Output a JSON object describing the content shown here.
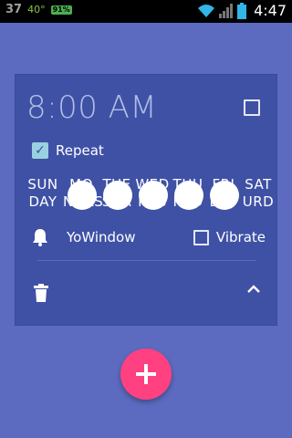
{
  "status_bar": {
    "left_number": "37",
    "weather_temp": "40°",
    "badge": "91%",
    "clock": "4:47"
  },
  "alarm": {
    "time": "8:00 AM",
    "enabled": false,
    "repeat": {
      "checked": true,
      "label": "Repeat"
    },
    "days": [
      {
        "lines": [
          "SUN",
          "DAY"
        ],
        "circled": false
      },
      {
        "lines": [
          "MO",
          "NDAS"
        ],
        "circled": true
      },
      {
        "lines": [
          "TUE",
          "SDA"
        ],
        "circled": true
      },
      {
        "lines": [
          "WED",
          "NES"
        ],
        "circled": true
      },
      {
        "lines": [
          "THU",
          "RSD"
        ],
        "circled": true
      },
      {
        "lines": [
          "FRI",
          "DAY"
        ],
        "circled": true
      },
      {
        "lines": [
          "SAT",
          "URD"
        ],
        "circled": false
      }
    ],
    "ringtone": "YoWindow",
    "vibrate": {
      "checked": false,
      "label": "Vibrate"
    }
  },
  "colors": {
    "background": "#5C6BC0",
    "card": "#3F51A5",
    "accent_fab": "#FF4081"
  },
  "icons": [
    "wifi-icon",
    "signal-icon",
    "battery-icon",
    "bell-icon",
    "trash-icon",
    "chevron-up-icon",
    "plus-icon"
  ]
}
